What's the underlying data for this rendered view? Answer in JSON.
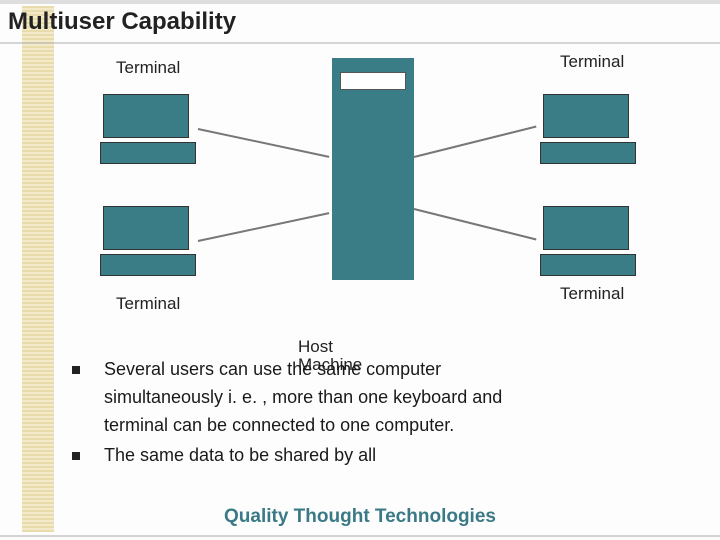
{
  "title": "Multiuser Capability",
  "labels": {
    "terminal_tl": "Terminal",
    "terminal_bl": "Terminal",
    "terminal_tr": "Terminal",
    "terminal_br": "Terminal",
    "host_line1": "Host",
    "host_line2": "Machine"
  },
  "bullets": {
    "b1_line1": "Several  users  can  use  the  same computer",
    "b1_line2": "simultaneously i. e. ,  more  than one keyboard and",
    "b1_line3": "terminal can be connected to one computer.",
    "b2": "The same data to be shared by all"
  },
  "footer": "Quality Thought Technologies",
  "colors": {
    "accent": "#3b7d87"
  }
}
